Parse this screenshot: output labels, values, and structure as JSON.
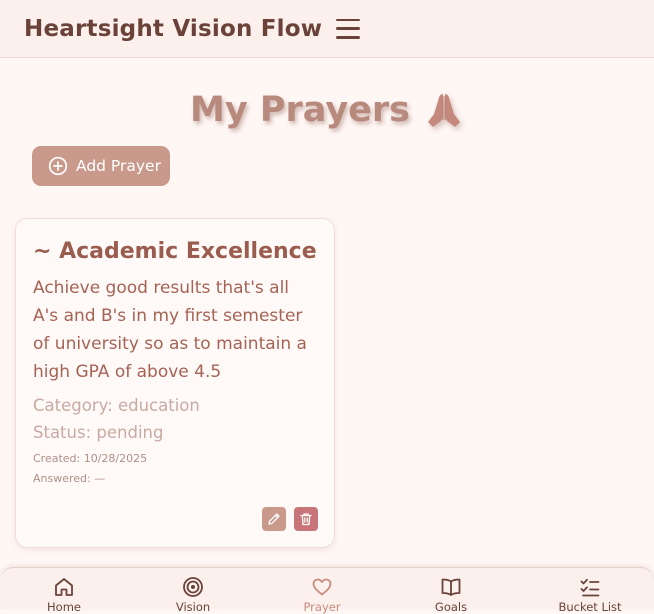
{
  "header": {
    "app_title": "Heartsight Vision Flow",
    "menu_icon": "hamburger-menu-icon"
  },
  "page": {
    "title": "My Prayers",
    "title_icon": "praying-hands-icon",
    "add_button_label": "Add Prayer"
  },
  "prayers": [
    {
      "title": "~ Academic Excellence",
      "description": "Achieve good results that's all A's and B's in my first semester of university so as to maintain a high GPA of above 4.5",
      "category": "Category: education",
      "status": "Status: pending",
      "created": "Created: 10/28/2025",
      "answered": "Answered: —"
    }
  ],
  "bottom_nav": {
    "items": [
      {
        "label": "Home",
        "icon": "home-icon",
        "active": false
      },
      {
        "label": "Vision",
        "icon": "target-icon",
        "active": false
      },
      {
        "label": "Prayer",
        "icon": "heart-icon",
        "active": true
      },
      {
        "label": "Goals",
        "icon": "book-icon",
        "active": false
      },
      {
        "label": "Bucket List",
        "icon": "checklist-icon",
        "active": false
      }
    ]
  },
  "colors": {
    "accent": "#c99a8c",
    "danger": "#c77578",
    "text_dark": "#6a4239",
    "background": "#fff7f4"
  }
}
